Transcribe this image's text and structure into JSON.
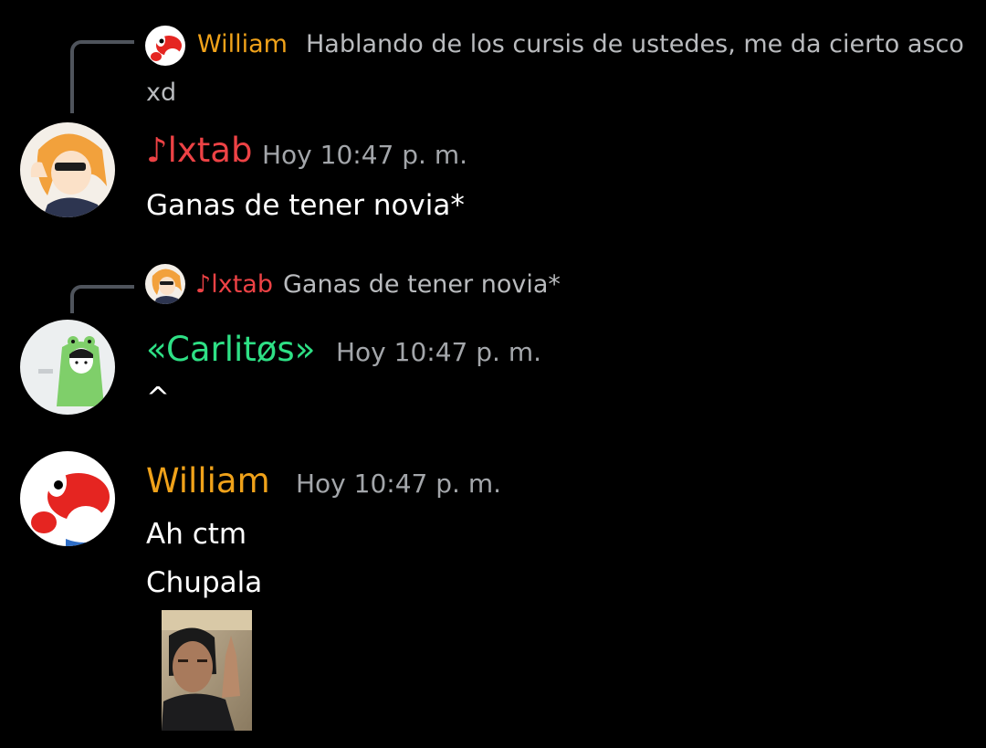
{
  "colors": {
    "background": "#000000",
    "william": "#f0a21a",
    "lxtab": "#ed4245",
    "carlitos": "#2ee085",
    "timestamp": "#a3a6aa",
    "reply_text": "#b9bbbe",
    "message_text": "#ffffff",
    "reply_line": "#4f545c"
  },
  "messages": [
    {
      "reply": {
        "author": "William",
        "text": "Hablando de los cursis de ustedes, me da cierto asco",
        "text_wrap": "xd"
      },
      "author": "♪lxtab",
      "timestamp": "Hoy 10:47 p. m.",
      "lines": [
        "Ganas de tener novia*"
      ]
    },
    {
      "reply": {
        "author": "♪lxtab",
        "text": "Ganas de tener novia*"
      },
      "author": "«Carlitøs»",
      "timestamp": "Hoy 10:47 p. m.",
      "lines": [
        "^"
      ]
    },
    {
      "author": "William",
      "timestamp": "Hoy 10:47 p. m.",
      "lines": [
        "Ah ctm",
        "Chupala"
      ],
      "attachment": "image-attachment"
    }
  ]
}
